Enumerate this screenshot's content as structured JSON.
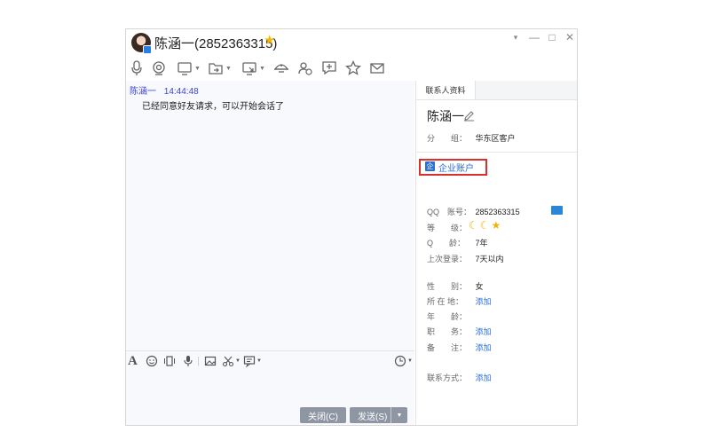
{
  "window": {
    "title": "陈涵一(2852363315)",
    "controls": {
      "menu": "▾",
      "minimize": "—",
      "maximize": "□",
      "close": "✕"
    }
  },
  "toolbar": {
    "icons": [
      "voice-call-icon",
      "video-call-icon",
      "screen-share-icon",
      "file-transfer-icon",
      "remote-assist-icon",
      "app-center-icon",
      "group-add-icon",
      "add-icon",
      "favorite-icon",
      "mail-icon"
    ]
  },
  "chat": {
    "messages": [
      {
        "sender": "陈涵一",
        "time": "14:44:48",
        "text": "已经同意好友请求，可以开始会话了"
      }
    ]
  },
  "input": {
    "close_label": "关闭(C)",
    "send_label": "发送(S)"
  },
  "panel": {
    "tab_label": "联系人资料",
    "name": "陈涵一",
    "group_label": "分　　组：",
    "group_value": "华东区客户",
    "enterprise_label": "企业账户",
    "enterprise_icon": "企",
    "qq_label": "QQ　账号：",
    "qq_value": "2852363315",
    "level_label": "等　　级：",
    "qage_label": "Q　　龄：",
    "qage_value": "7年",
    "lastlogin_label": "上次登录：",
    "lastlogin_value": "7天以内",
    "gender_label": "性　　别：",
    "gender_value": "女",
    "location_label": "所 在 地：",
    "location_value": "添加",
    "age_label": "年　　龄：",
    "job_label": "职　　务：",
    "job_value": "添加",
    "note_label": "备　　注：",
    "note_value": "添加",
    "contact_label": "联系方式：",
    "contact_value": "添加",
    "level_icons": [
      "moon-icon",
      "moon-icon",
      "star-icon"
    ],
    "accent_color": "#2a6ed6",
    "highlight_color": "#d9302c"
  }
}
